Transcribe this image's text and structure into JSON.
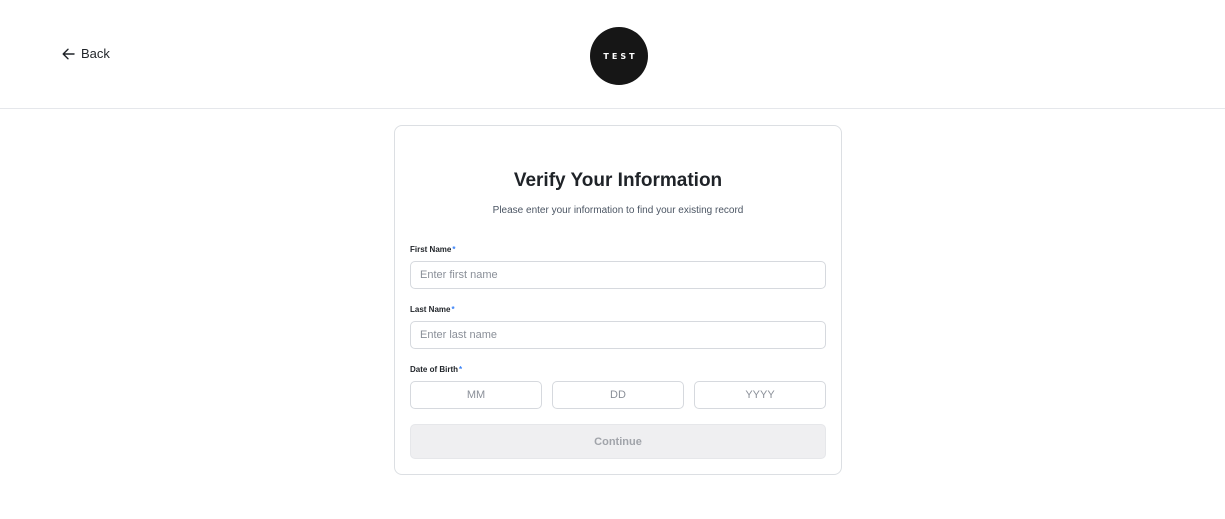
{
  "header": {
    "back_label": "Back",
    "logo_text": "TEST"
  },
  "form": {
    "title": "Verify Your Information",
    "subtitle": "Please enter your information to find your existing record",
    "required_marker": "*",
    "first_name": {
      "label": "First Name",
      "placeholder": "Enter first name",
      "value": ""
    },
    "last_name": {
      "label": "Last Name",
      "placeholder": "Enter last name",
      "value": ""
    },
    "dob": {
      "label": "Date of Birth",
      "month_placeholder": "MM",
      "day_placeholder": "DD",
      "year_placeholder": "YYYY"
    },
    "continue_label": "Continue",
    "continue_disabled": true
  },
  "colors": {
    "required_marker": "#3b82f6",
    "logo_bg": "#161616",
    "button_disabled_bg": "#efeff1"
  },
  "icons": {
    "back": "arrow-left-icon"
  }
}
